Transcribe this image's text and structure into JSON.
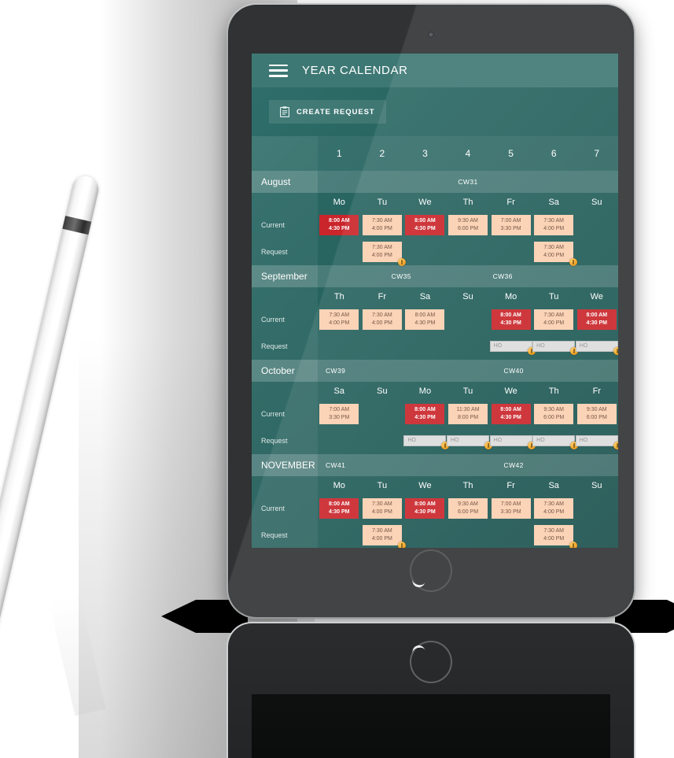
{
  "app": {
    "title": "YEAR CALENDAR",
    "menu_icon": "hamburger-menu-icon",
    "create_button": "CREATE REQUEST",
    "create_icon": "clipboard-icon"
  },
  "grid": {
    "day_numbers": [
      "1",
      "2",
      "3",
      "4",
      "5",
      "6",
      "7"
    ],
    "row_labels": {
      "current": "Current",
      "request": "Request"
    },
    "ho_placeholder": "HO"
  },
  "months": [
    {
      "name": "August",
      "weeks": [
        {
          "label": "CW31",
          "span": 7
        }
      ],
      "days": [
        "Mo",
        "Tu",
        "We",
        "Th",
        "Fr",
        "Sa",
        "Su"
      ],
      "current": [
        {
          "start": "8:00 AM",
          "end": "4:30 PM",
          "type": "red"
        },
        {
          "start": "7:30 AM",
          "end": "4:00 PM",
          "type": "peach"
        },
        {
          "start": "8:00 AM",
          "end": "4:30 PM",
          "type": "red"
        },
        {
          "start": "9:30 AM",
          "end": "6:00 PM",
          "type": "peach"
        },
        {
          "start": "7:00 AM",
          "end": "3:30 PM",
          "type": "peach"
        },
        {
          "start": "7:30 AM",
          "end": "4:00 PM",
          "type": "peach"
        },
        null
      ],
      "request": [
        null,
        {
          "start": "7:30 AM",
          "end": "4:00 PM",
          "type": "peach",
          "badge": true
        },
        null,
        null,
        null,
        {
          "start": "7:30 AM",
          "end": "4:00 PM",
          "type": "peach",
          "badge": true
        },
        null
      ]
    },
    {
      "name": "September",
      "weeks": [
        {
          "label": "CW35",
          "span": 4
        },
        {
          "label": "CW36",
          "span": 3
        }
      ],
      "days": [
        "Th",
        "Fr",
        "Sa",
        "Su",
        "Mo",
        "Tu",
        "We"
      ],
      "current": [
        {
          "start": "7:30 AM",
          "end": "4:00 PM",
          "type": "peach"
        },
        {
          "start": "7:30 AM",
          "end": "4:00 PM",
          "type": "peach"
        },
        {
          "start": "8:00 AM",
          "end": "4:30 PM",
          "type": "peach"
        },
        null,
        {
          "start": "8:00 AM",
          "end": "4:30 PM",
          "type": "red"
        },
        {
          "start": "7:30 AM",
          "end": "4:00 PM",
          "type": "peach"
        },
        {
          "start": "8:00 AM",
          "end": "4:30 PM",
          "type": "red"
        }
      ],
      "request": [
        null,
        null,
        null,
        null,
        {
          "type": "ho",
          "value": "HO",
          "badge": true
        },
        {
          "type": "ho",
          "value": "HO",
          "badge": true
        },
        {
          "type": "ho",
          "value": "HO",
          "badge": true
        }
      ]
    },
    {
      "name": "October",
      "weeks": [
        {
          "label": "CW39",
          "span": 2
        },
        {
          "label": "CW40",
          "span": 5
        }
      ],
      "days": [
        "Sa",
        "Su",
        "Mo",
        "Tu",
        "We",
        "Th",
        "Fr"
      ],
      "current": [
        {
          "start": "7:00 AM",
          "end": "3:30 PM",
          "type": "peach"
        },
        null,
        {
          "start": "8:00 AM",
          "end": "4:30 PM",
          "type": "red"
        },
        {
          "start": "11:30 AM",
          "end": "8:00 PM",
          "type": "peach"
        },
        {
          "start": "8:00 AM",
          "end": "4:30 PM",
          "type": "red"
        },
        {
          "start": "9:30 AM",
          "end": "6:00 PM",
          "type": "peach"
        },
        {
          "start": "9:30 AM",
          "end": "6:00 PM",
          "type": "peach"
        }
      ],
      "request": [
        null,
        null,
        {
          "type": "ho",
          "value": "HO",
          "badge": true
        },
        {
          "type": "ho",
          "value": "HO",
          "badge": true
        },
        {
          "type": "ho",
          "value": "HO",
          "badge": true
        },
        {
          "type": "ho",
          "value": "HO",
          "badge": true
        },
        {
          "type": "ho",
          "value": "HO",
          "badge": true
        }
      ]
    },
    {
      "name": "NOVEMBER",
      "weeks": [
        {
          "label": "CW41",
          "span": 2
        },
        {
          "label": "CW42",
          "span": 5
        }
      ],
      "days": [
        "Mo",
        "Tu",
        "We",
        "Th",
        "Fr",
        "Sa",
        "Su"
      ],
      "current": [
        {
          "start": "8:00 AM",
          "end": "4:30 PM",
          "type": "red"
        },
        {
          "start": "7:30 AM",
          "end": "4:00 PM",
          "type": "peach"
        },
        {
          "start": "8:00 AM",
          "end": "4:30 PM",
          "type": "red"
        },
        {
          "start": "9:30 AM",
          "end": "6:00 PM",
          "type": "peach"
        },
        {
          "start": "7:00 AM",
          "end": "3:30 PM",
          "type": "peach"
        },
        {
          "start": "7:30 AM",
          "end": "4:00 PM",
          "type": "peach"
        },
        null
      ],
      "request": [
        null,
        {
          "start": "7:30 AM",
          "end": "4:00 PM",
          "type": "peach",
          "badge": true
        },
        null,
        null,
        null,
        {
          "start": "7:30 AM",
          "end": "4:00 PM",
          "type": "peach",
          "badge": true
        },
        null
      ]
    }
  ],
  "colors": {
    "accent_teal": "#3e7874",
    "screen_teal": "#1f5a56",
    "chip_red": "#c9252b",
    "chip_peach": "#fbcfb0",
    "badge_orange": "#ef9c15",
    "ho_field": "#dcdcdc"
  }
}
